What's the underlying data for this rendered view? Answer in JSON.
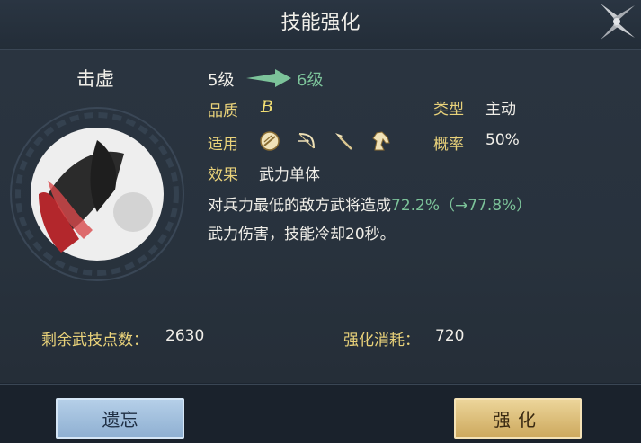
{
  "header": {
    "title": "技能强化"
  },
  "skill": {
    "name": "击虚",
    "level_from": "5级",
    "level_to": "6级",
    "quality_label": "品质",
    "quality_value": "B",
    "type_label": "类型",
    "type_value": "主动",
    "applicable_label": "适用",
    "applicable_icons": [
      "shield-unit-icon",
      "bow-unit-icon",
      "spear-unit-icon",
      "horse-unit-icon"
    ],
    "rate_label": "概率",
    "rate_value": "50%",
    "effect_label": "效果",
    "effect_value": "武力单体",
    "desc_prefix": "对兵力最低的敌方武将造成",
    "desc_value": "72.2%（→77.8%）",
    "desc_line2": "武力伤害，技能冷却20秒。"
  },
  "stats": {
    "remaining_label": "剩余武技点数：",
    "remaining_value": "2630",
    "cost_label": "强化消耗：",
    "cost_value": "720"
  },
  "buttons": {
    "forget": "遗忘",
    "upgrade": "强化"
  },
  "colors": {
    "label_gold": "#e9d27a",
    "accent_green": "#7cc39a",
    "upgrade_btn": "#d8b66e",
    "forget_btn": "#a4c1df"
  }
}
